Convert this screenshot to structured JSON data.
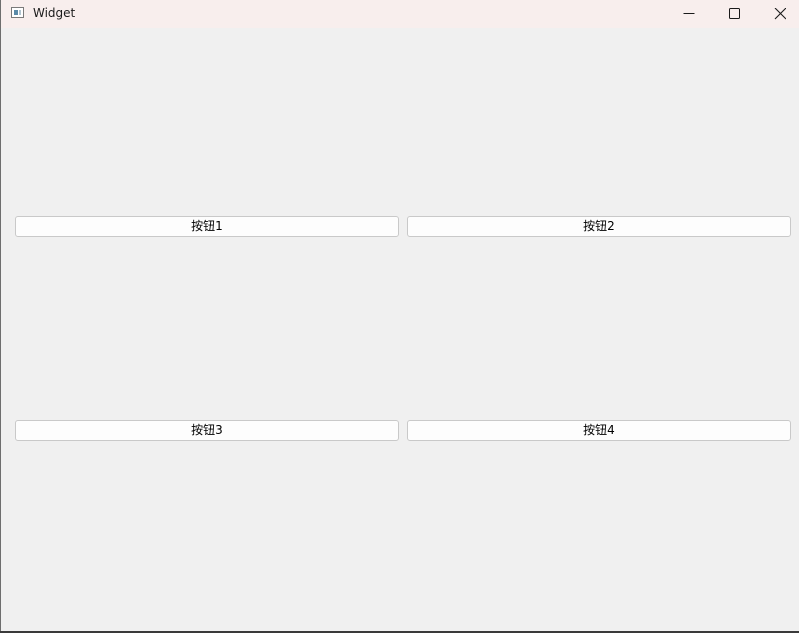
{
  "window": {
    "title": "Widget",
    "icon": "app-window-icon"
  },
  "titlebar": {
    "minimize_icon": "minimize-icon",
    "maximize_icon": "maximize-icon",
    "close_icon": "close-icon"
  },
  "buttons": [
    {
      "label": "按钮1"
    },
    {
      "label": "按钮2"
    },
    {
      "label": "按钮3"
    },
    {
      "label": "按钮4"
    }
  ]
}
